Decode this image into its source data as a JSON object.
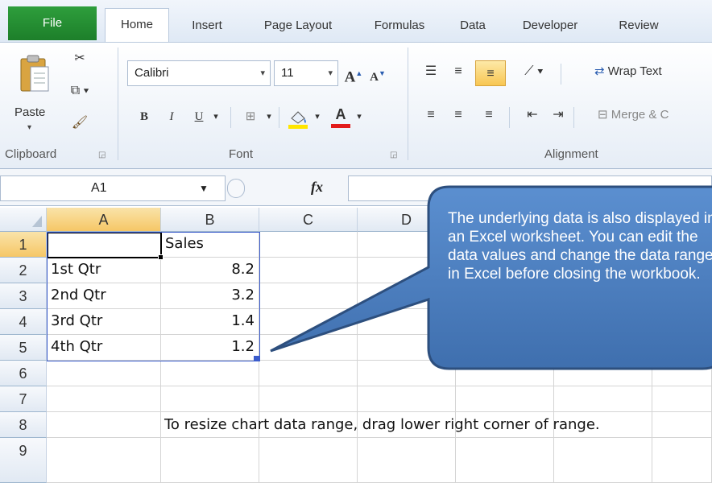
{
  "tabs": [
    "File",
    "Home",
    "Insert",
    "Page Layout",
    "Formulas",
    "Data",
    "Developer",
    "Review"
  ],
  "clipboard": {
    "paste_label": "Paste",
    "group_label": "Clipboard"
  },
  "font": {
    "name": "Calibri",
    "size": "11",
    "group_label": "Font",
    "bold": "B",
    "italic": "I",
    "underline": "U",
    "grow": "A",
    "shrink": "A",
    "font_color": "A"
  },
  "alignment": {
    "wrap_text": "Wrap Text",
    "merge": "Merge & C",
    "group_label": "Alignment"
  },
  "formula_bar": {
    "name_box": "A1",
    "fx": "fx",
    "value": ""
  },
  "columns": [
    "A",
    "B",
    "C",
    "D"
  ],
  "rows": [
    {
      "num": "1",
      "a": "",
      "b": "Sales"
    },
    {
      "num": "2",
      "a": "1st Qtr",
      "b": "8.2"
    },
    {
      "num": "3",
      "a": "2nd Qtr",
      "b": "3.2"
    },
    {
      "num": "4",
      "a": "3rd Qtr",
      "b": "1.4"
    },
    {
      "num": "5",
      "a": "4th Qtr",
      "b": "1.2"
    },
    {
      "num": "6",
      "a": "",
      "b": ""
    },
    {
      "num": "7",
      "a": "",
      "b": ""
    },
    {
      "num": "8",
      "a": "",
      "b": ""
    },
    {
      "num": "9",
      "a": "",
      "b": ""
    }
  ],
  "row8_note": "To resize chart data range, drag lower right corner of range.",
  "callout": {
    "text": "The underlying data is also displayed in an Excel worksheet. You can edit the data values and change the data range in Excel before closing the workbook."
  },
  "colors": {
    "file_tab": "#1d7f2a",
    "callout_fill": "#4a7ebb",
    "selection_border": "#3b5ccc",
    "ribbon": "#e6edf6"
  }
}
